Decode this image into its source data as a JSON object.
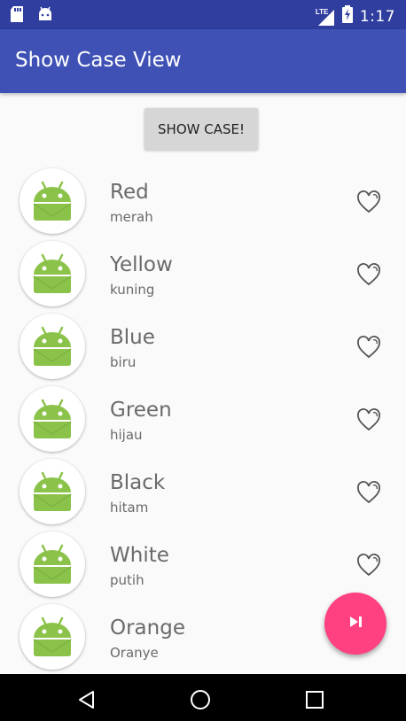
{
  "status_bar": {
    "time": "1:17",
    "network_label": "LTE",
    "left_icons": [
      "sd-card-icon",
      "android-notification-icon"
    ],
    "right_icons": [
      "lte-signal-icon",
      "battery-charging-icon"
    ]
  },
  "app_bar": {
    "title": "Show Case View"
  },
  "show_case_button": {
    "label": "SHOW CASE!"
  },
  "list": {
    "items": [
      {
        "title": "Red",
        "subtitle": "merah"
      },
      {
        "title": "Yellow",
        "subtitle": "kuning"
      },
      {
        "title": "Blue",
        "subtitle": "biru"
      },
      {
        "title": "Green",
        "subtitle": "hijau"
      },
      {
        "title": "Black",
        "subtitle": "hitam"
      },
      {
        "title": "White",
        "subtitle": "putih"
      },
      {
        "title": "Orange",
        "subtitle": "Oranye"
      }
    ]
  },
  "fab": {
    "icon": "skip-next-icon",
    "color": "#ff4081"
  },
  "nav_bar": {
    "buttons": [
      "back-icon",
      "home-icon",
      "recents-icon"
    ]
  },
  "colors": {
    "primary": "#3f51b5",
    "primary_dark": "#303f9f",
    "accent": "#ff4081",
    "android_green": "#8bc34a"
  }
}
